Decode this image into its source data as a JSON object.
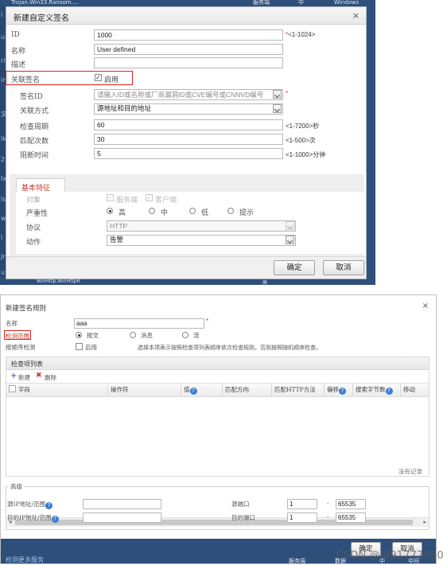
{
  "background": {
    "top_texts": [
      "Trojan.Win33.Ransom....",
      "服务端",
      "中",
      "Windows"
    ],
    "edge_letters": [
      "i",
      "u",
      "ri",
      "in",
      "文",
      "lk",
      "2",
      "Ix",
      "ls",
      "w",
      "l",
      "Jr",
      "u"
    ],
    "bottom_texts": [
      "WinHttp.WinHttpR",
      "高"
    ]
  },
  "dialog1": {
    "title": "新建自定义签名",
    "close": "×",
    "fields": {
      "id": {
        "label": "ID",
        "value": "1000",
        "hint": "<1-1024>"
      },
      "name": {
        "label": "名称",
        "value": "User defined"
      },
      "desc": {
        "label": "描述",
        "value": ""
      },
      "assoc": {
        "label": "关联签名",
        "checkbox_label": "启用"
      },
      "sig_id": {
        "label": "签名ID",
        "placeholder": "请输入ID或名称或厂商漏洞ID或CVE编号或CNNVD编号"
      },
      "assoc_mode": {
        "label": "关联方式",
        "value": "源地址和目的地址"
      },
      "period": {
        "label": "检查周期",
        "value": "60",
        "hint": "<1-7200>秒"
      },
      "count": {
        "label": "匹配次数",
        "value": "30",
        "hint": "<1-500>次"
      },
      "block": {
        "label": "阻断时间",
        "value": "5",
        "hint": "<1-1000>分钟"
      }
    },
    "basic": {
      "tab": "基本特征",
      "target_label": "对象",
      "target_options": [
        "服务端",
        "客户端"
      ],
      "severity_label": "严重性",
      "severity_options": [
        "高",
        "中",
        "低",
        "提示"
      ],
      "protocol_label": "协议",
      "protocol_value": "HTTP",
      "action_label": "动作",
      "action_value": "告警"
    },
    "buttons": {
      "ok": "确定",
      "cancel": "取消"
    }
  },
  "dialog2": {
    "title": "新建签名规则",
    "close": "×",
    "name_label": "名称",
    "name_value": "aaa",
    "scope_label": "检测范围",
    "scope_options": [
      "报文",
      "消息",
      "流"
    ],
    "order_label": "按顺序检测",
    "order_checkbox": "启用",
    "order_desc": "选择本项表示按照检查项列表顺序依次检查规则，否则按照随机顺序检查。",
    "grid": {
      "title": "检查项列表",
      "new": "新建",
      "delete": "删除",
      "columns": [
        "字段",
        "操作符",
        "值",
        "匹配方向",
        "匹配HTTP方法",
        "偏移",
        "搜索字节数",
        "移动"
      ],
      "empty": "没有记录"
    },
    "advanced": {
      "legend": "高级",
      "src_ip": "源IP地址/范围",
      "dst_ip": "目的IP地址/范围",
      "src_port": "源端口",
      "dst_port": "目的端口",
      "port_from": "1",
      "port_to": "65535",
      "dash": "-"
    },
    "buttons": {
      "ok": "确定",
      "cancel": "取消"
    },
    "footer": {
      "link": "检测更多服务",
      "cols": [
        "服务端",
        "数据",
        "中",
        "中间"
      ]
    }
  },
  "watermark": "CSDN @l891777980"
}
